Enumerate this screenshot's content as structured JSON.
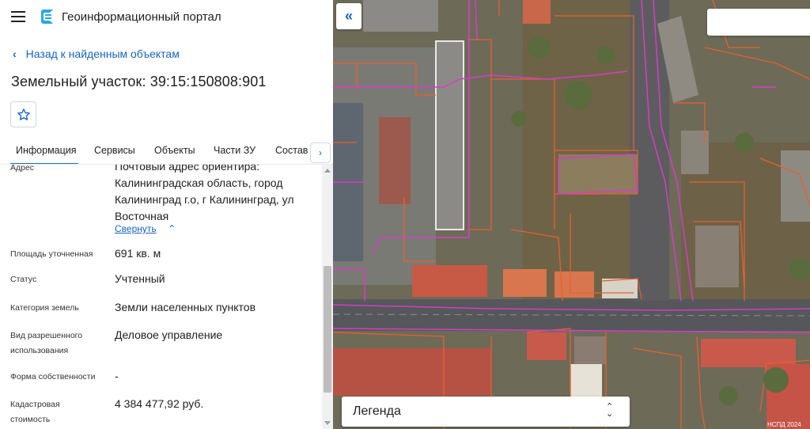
{
  "header": {
    "app_title": "Геоинформационный портал",
    "menu_icon": "hamburger-menu-icon",
    "logo_icon": "portal-logo-icon"
  },
  "navigation": {
    "back_label": "Назад к найденным объектам"
  },
  "object": {
    "title": "Земельный участок: 39:15:150808:901"
  },
  "tabs": [
    {
      "label": "Информация",
      "active": true
    },
    {
      "label": "Сервисы",
      "active": false
    },
    {
      "label": "Объекты",
      "active": false
    },
    {
      "label": "Части ЗУ",
      "active": false
    },
    {
      "label": "Состав",
      "active": false
    }
  ],
  "details": {
    "address_label": "Адрес",
    "address_value": "Почтовый адрес ориентира: Калининградская область, город Калининград г.о, г Калининград, ул Восточная",
    "collapse_label": "Свернуть",
    "area_label": "Площадь уточненная",
    "area_value": "691 кв. м",
    "status_label": "Статус",
    "status_value": "Учтенный",
    "category_label": "Категория земель",
    "category_value": "Земли населенных пунктов",
    "permitted_use_label": "Вид разрешенного использования",
    "permitted_use_value": "Деловое управление",
    "ownership_label": "Форма собственности",
    "ownership_value": "-",
    "cadastral_cost_label": "Кадастровая стоимость",
    "cadastral_cost_value": "4 384 477,92 руб."
  },
  "map": {
    "collapse_button": "«",
    "search_placeholder": "",
    "legend_label": "Легенда",
    "watermark": "НСПД 2024"
  },
  "colors": {
    "accent": "#1976d2",
    "link": "#1565c0",
    "parcel_border": "#e8602c",
    "zone_border": "#d63cc8"
  }
}
